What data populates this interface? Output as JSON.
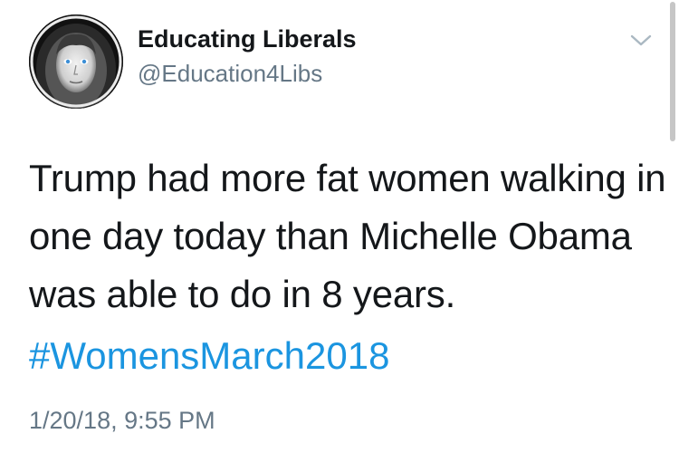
{
  "author": {
    "display_name": "Educating Liberals",
    "handle": "@Education4Libs",
    "avatar_icon": "profile-photo"
  },
  "tweet": {
    "text_lines": [
      "Trump had more fat women walking in",
      "one day today than Michelle Obama",
      "was able to do in 8 years."
    ],
    "hashtag": "#WomensMarch2018",
    "timestamp": "1/20/18, 9:55 PM"
  },
  "menu": {
    "icon": "chevron-down-icon"
  },
  "colors": {
    "text": "#14171a",
    "secondary": "#657786",
    "link": "#1b95e0",
    "background": "#ffffff"
  }
}
